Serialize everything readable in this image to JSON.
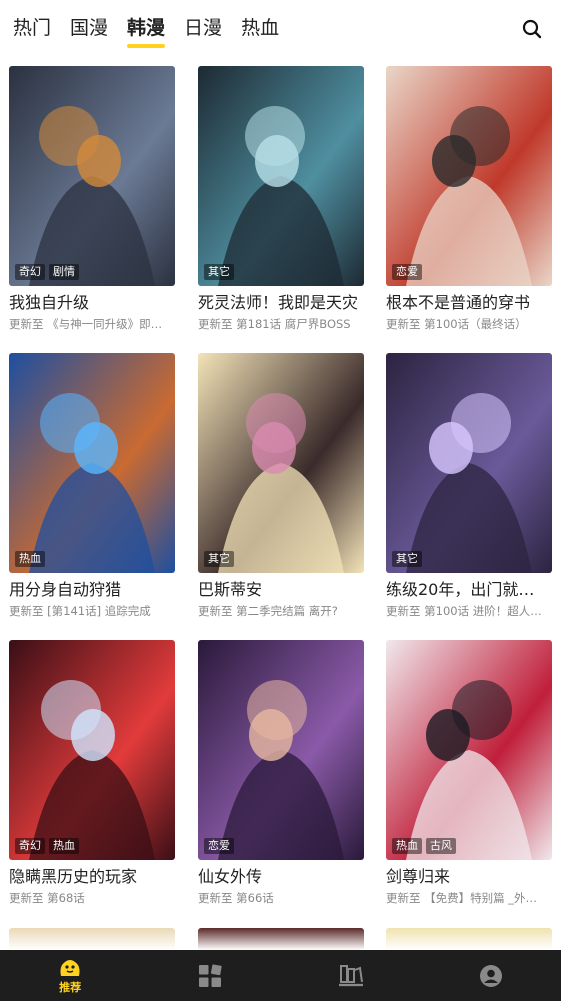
{
  "tabs": [
    {
      "label": "热门",
      "active": false
    },
    {
      "label": "国漫",
      "active": false
    },
    {
      "label": "韩漫",
      "active": true
    },
    {
      "label": "日漫",
      "active": false
    },
    {
      "label": "热血",
      "active": false
    }
  ],
  "comics": [
    {
      "title": "我独自升级",
      "update": "更新至 《与神一同升级》即…",
      "tags": [
        "奇幻",
        "剧情"
      ],
      "palette": [
        "#2b3140",
        "#6b7a95",
        "#d58a3a"
      ]
    },
    {
      "title": "死灵法师！我即是天灾",
      "update": "更新至 第181话 腐尸界BOSS",
      "tags": [
        "其它"
      ],
      "palette": [
        "#1d2a33",
        "#4f8fa0",
        "#b8e0e8"
      ]
    },
    {
      "title": "根本不是普通的穿书",
      "update": "更新至 第100话（最终话）",
      "tags": [
        "恋爱"
      ],
      "palette": [
        "#e9d6c8",
        "#c0392b",
        "#2a2a2a"
      ]
    },
    {
      "title": "用分身自动狩猎",
      "update": "更新至 [第141话] 追踪完成",
      "tags": [
        "热血"
      ],
      "palette": [
        "#1e4fa0",
        "#c96a32",
        "#5ab6ff"
      ]
    },
    {
      "title": "巴斯蒂安",
      "update": "更新至 第二季完结篇 离开?",
      "tags": [
        "其它"
      ],
      "palette": [
        "#f3e3b8",
        "#3a2a2a",
        "#d98bb0"
      ]
    },
    {
      "title": "练级20年，出门就…",
      "update": "更新至 第100话 进阶！超人…",
      "tags": [
        "其它"
      ],
      "palette": [
        "#2c2440",
        "#6a5a9a",
        "#d7c7ff"
      ]
    },
    {
      "title": "隐瞒黑历史的玩家",
      "update": "更新至 第68话",
      "tags": [
        "奇幻",
        "热血"
      ],
      "palette": [
        "#3a0f16",
        "#e23b3b",
        "#cfe6ff"
      ]
    },
    {
      "title": "仙女外传",
      "update": "更新至 第66话",
      "tags": [
        "恋爱"
      ],
      "palette": [
        "#2a1a3a",
        "#8a5aa8",
        "#e7b8a0"
      ]
    },
    {
      "title": "剑尊归来",
      "update": "更新至 【免费】特别篇 _外…",
      "tags": [
        "热血",
        "古风"
      ],
      "palette": [
        "#f0e8ec",
        "#c01f3a",
        "#1a1a22"
      ]
    }
  ],
  "peek_colors": [
    "#e9d9b6",
    "#5a2a2a",
    "#efe2b0"
  ],
  "bottom_nav": {
    "items": [
      {
        "name": "recommend",
        "label": "推荐",
        "icon": "duck-icon",
        "active": true
      },
      {
        "name": "category",
        "label": "",
        "icon": "grid-icon",
        "active": false
      },
      {
        "name": "shelf",
        "label": "",
        "icon": "bookshelf-icon",
        "active": false
      },
      {
        "name": "profile",
        "label": "",
        "icon": "user-icon",
        "active": false
      }
    ]
  },
  "accent": "#ffd21f"
}
